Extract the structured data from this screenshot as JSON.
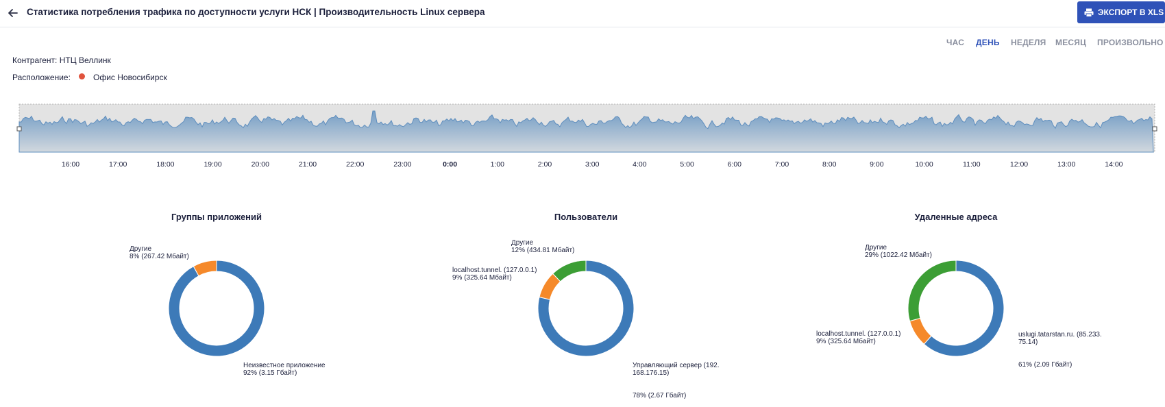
{
  "header": {
    "title": "Статистика потребления трафика по доступности услуги НСК | Производительность Linux сервера",
    "export_label": "ЭКСПОРТ В XLS"
  },
  "period_tabs": [
    {
      "label": "ЧАС",
      "active": false
    },
    {
      "label": "ДЕНЬ",
      "active": true
    },
    {
      "label": "НЕДЕЛЯ",
      "active": false
    },
    {
      "label": "МЕСЯЦ",
      "active": false
    },
    {
      "label": "ПРОИЗВОЛЬНО",
      "active": false
    }
  ],
  "info": {
    "contractor_label": "Контрагент:",
    "contractor_value": "НТЦ Веллинк",
    "location_label": "Расположение:",
    "location_value": "Офис Новосибирск",
    "location_status_color": "#e0533d"
  },
  "timeline": {
    "ticks": [
      "16:00",
      "17:00",
      "18:00",
      "19:00",
      "20:00",
      "21:00",
      "22:00",
      "23:00",
      "0:00",
      "1:00",
      "2:00",
      "3:00",
      "4:00",
      "5:00",
      "6:00",
      "7:00",
      "8:00",
      "9:00",
      "10:00",
      "11:00",
      "12:00",
      "13:00",
      "14:00"
    ],
    "bold_tick": "0:00",
    "area_color": "#6f9ac4"
  },
  "colors": {
    "blue": "#3d7ab8",
    "orange": "#f5892a",
    "green": "#3c9e35",
    "accent": "#2f52b8"
  },
  "donuts": [
    {
      "title": "Группы приложений",
      "slices": [
        {
          "name": "Неизвестное приложение",
          "value_text": "92% (3.15 Гбайт)",
          "percent": 92,
          "color": "#3d7ab8"
        },
        {
          "name": "Другие",
          "value_text": "8% (267.42 Мбайт)",
          "percent": 8,
          "color": "#f5892a"
        }
      ]
    },
    {
      "title": "Пользователи",
      "slices": [
        {
          "name": "Управляющий сервер (192.\n168.176.15)",
          "value_text": "78% (2.67 Гбайт)",
          "percent": 78,
          "color": "#3d7ab8"
        },
        {
          "name": "localhost.tunnel. (127.0.0.1)",
          "value_text": "9% (325.64 Мбайт)",
          "percent": 9,
          "color": "#f5892a"
        },
        {
          "name": "Другие",
          "value_text": "12% (434.81 Мбайт)",
          "percent": 12,
          "color": "#3c9e35"
        }
      ]
    },
    {
      "title": "Удаленные адреса",
      "slices": [
        {
          "name": "uslugi.tatarstan.ru. (85.233.\n75.14)",
          "value_text": "61% (2.09 Гбайт)",
          "percent": 61,
          "color": "#3d7ab8"
        },
        {
          "name": "localhost.tunnel. (127.0.0.1)",
          "value_text": "9% (325.64 Мбайт)",
          "percent": 9,
          "color": "#f5892a"
        },
        {
          "name": "Другие",
          "value_text": "29% (1022.42 Мбайт)",
          "percent": 29,
          "color": "#3c9e35"
        }
      ]
    }
  ]
}
